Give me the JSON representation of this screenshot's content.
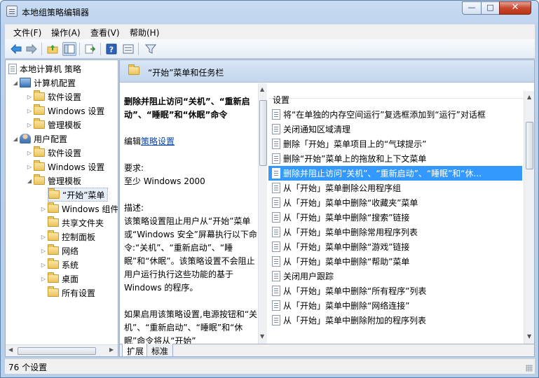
{
  "window": {
    "title": "本地组策略编辑器",
    "minimize_glyph": "—",
    "maximize_glyph": "□",
    "close_glyph": "✕"
  },
  "menu": [
    "文件(F)",
    "操作(A)",
    "查看(V)",
    "帮助(H)"
  ],
  "toolbar": {
    "icons": [
      "back-icon",
      "forward-icon",
      "up-folder-icon",
      "show-hide-tree-icon",
      "export-list-icon",
      "help-icon",
      "properties-pane-icon",
      "filter-icon"
    ]
  },
  "tree": {
    "root": "本地计算机 策略",
    "computer_config": "计算机配置",
    "computer_children": [
      "软件设置",
      "Windows 设置",
      "管理模板"
    ],
    "user_config": "用户配置",
    "user_children": [
      "软件设置",
      "Windows 设置",
      "管理模板"
    ],
    "admin_templates_children": [
      "“开始”菜单",
      "Windows 组件",
      "共享文件夹",
      "控制面板",
      "网络",
      "系统",
      "桌面",
      "所有设置"
    ]
  },
  "header": {
    "title": "“开始”菜单和任务栏"
  },
  "description": {
    "title": "删除并阻止访问“关机”、“重新启动”、“睡眠”和“休眠”命令",
    "edit_prefix": "编辑",
    "edit_link": "策略设置",
    "req_label": "要求:",
    "req_value": "至少 Windows 2000",
    "desc_label": "描述:",
    "desc_text": "该策略设置阻止用户从“开始”菜单或“Windows 安全”屏幕执行以下命令:“关机”、“重新启动”、“睡眠”和“休眠”。该策略设置不会阻止用户运行执行这些功能的基于 Windows 的程序。",
    "more_text": "如果启用该策略设置,电源按钮和“关机”、“重新启动”、“睡眠”和“休眠”命令将从“开始”"
  },
  "list": {
    "column": "设置",
    "items": [
      "将“在单独的内存空间运行”复选框添加到“运行”对话框",
      "关闭通知区域清理",
      "删除「开始」菜单项目上的“气球提示”",
      "删除“开始”菜单上的拖放和上下文菜单",
      "删除并阻止访问“关机”、“重新启动”、“睡眠”和“休...",
      "从「开始」菜单删除公用程序组",
      "从「开始」菜单中删除“收藏夹”菜单",
      "从「开始」菜单中删除“搜索”链接",
      "从「开始」菜单中删除常用程序列表",
      "从「开始」菜单中删除“游戏”链接",
      "从「开始」菜单中删除“帮助”菜单",
      "关闭用户跟踪",
      "从「开始」菜单中删除“所有程序”列表",
      "从「开始」菜单中删除“网络连接”",
      "从「开始」菜单中删除附加的程序列表"
    ],
    "selected_index": 4
  },
  "tabs": [
    "扩展",
    "标准"
  ],
  "status": "76 个设置"
}
